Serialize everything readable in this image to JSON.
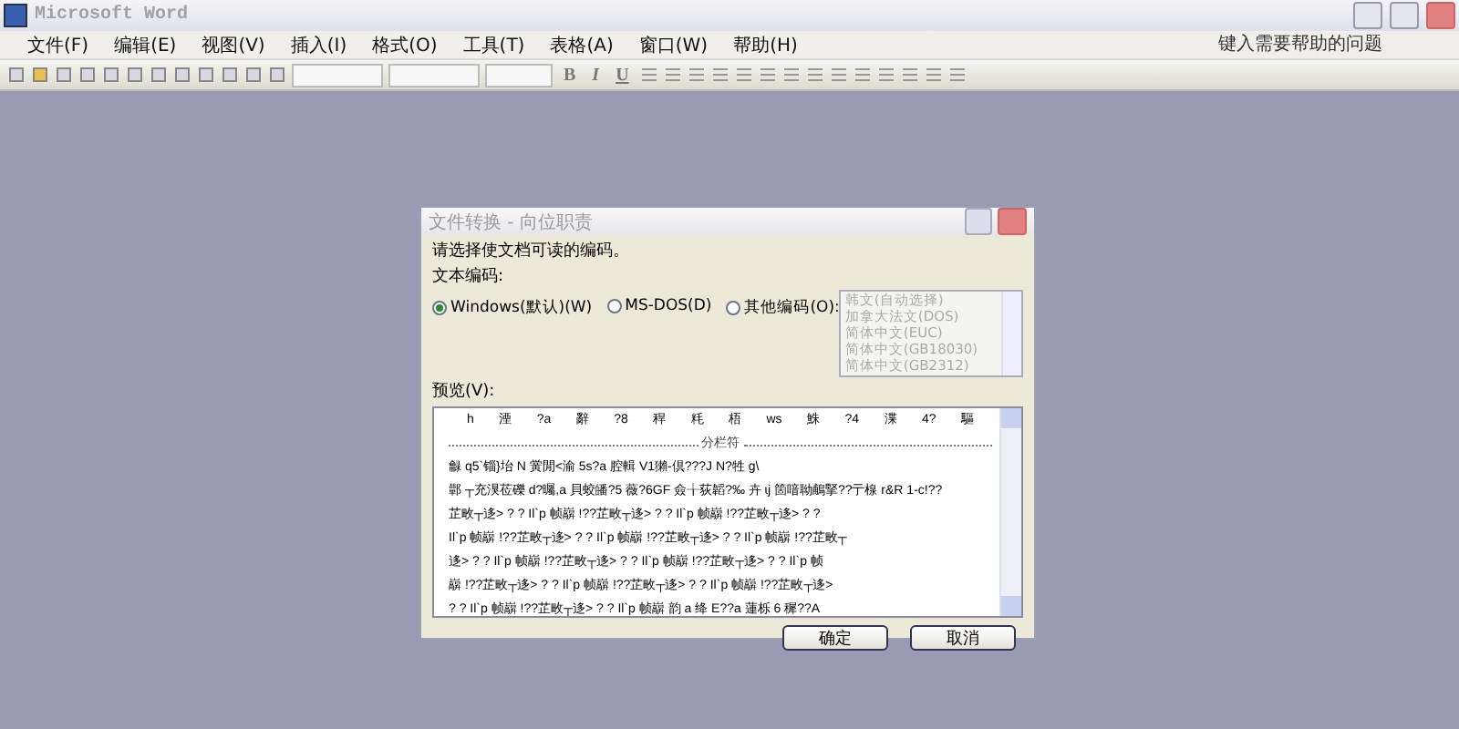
{
  "window": {
    "title": "Microsoft Word"
  },
  "menu": [
    "文件(F)",
    "编辑(E)",
    "视图(V)",
    "插入(I)",
    "格式(O)",
    "工具(T)",
    "表格(A)",
    "窗口(W)",
    "帮助(H)"
  ],
  "help_box": {
    "placeholder": "键入需要帮助的问题"
  },
  "format_buttons": [
    "B",
    "I",
    "U"
  ],
  "dialog": {
    "title": "文件转换 - 向位职责",
    "prompt": "请选择使文档可读的编码。",
    "encoding_label": "文本编码:",
    "options": [
      {
        "label": "Windows(默认)(W)",
        "selected": true
      },
      {
        "label": "MS-DOS(D)",
        "selected": false
      },
      {
        "label": "其他编码(O):",
        "selected": false
      }
    ],
    "encodings": {
      "disabled": true,
      "items": [
        "韩文(自动选择)",
        "加拿大法文(DOS)",
        "简体中文(EUC)",
        "简体中文(GB18030)",
        "简体中文(GB2312)"
      ]
    },
    "preview_label": "预览(V):",
    "preview_header": [
      "h",
      "湮",
      "?a",
      "辭",
      "?8",
      "稈",
      "粍",
      "梧",
      "ws",
      "鮢",
      "?4",
      "渫",
      "4?",
      "驅"
    ],
    "separator": "分栏符",
    "preview_lines": [
      "龣 q5`锱}坮 N 黉閒<渝 5s?a 腔輯 V1獺-倶???J   N?牲 g\\",
      "鄿  ┬充湨莅礫 d?曯,a 貝蛟皤?5 薇?6GF 僉╁荻韜?‰ 卉 ɩj 箇喑聈鵏掔??亍楾 r&R 1-c!??",
      "芷畋┬迻> ? ?   Il`p 帧巐  !??芷畋┬迻> ? ?   Il`p 帧巐  !??芷畋┬迻> ? ?",
      "Il`p 帧巐  !??芷畋┬迻> ? ?   Il`p 帧巐  !??芷畋┬迻> ? ?   Il`p 帧巐  !??芷畋┬",
      "迻> ? ?   Il`p 帧巐  !??芷畋┬迻> ? ?   Il`p 帧巐  !??芷畋┬迻> ? ?   Il`p 帧",
      "巐  !??芷畋┬迻> ? ?   Il`p 帧巐  !??芷畋┬迻> ? ?   Il`p 帧巐  !??芷畋┬迻>",
      "? ?   Il`p 帧巐  !??芷畋┬迻> ? ?   Il`p 帧巐  韵 a 绛 E??a 蓮栎 6 穉??A"
    ],
    "buttons": [
      "确定",
      "取消"
    ]
  }
}
